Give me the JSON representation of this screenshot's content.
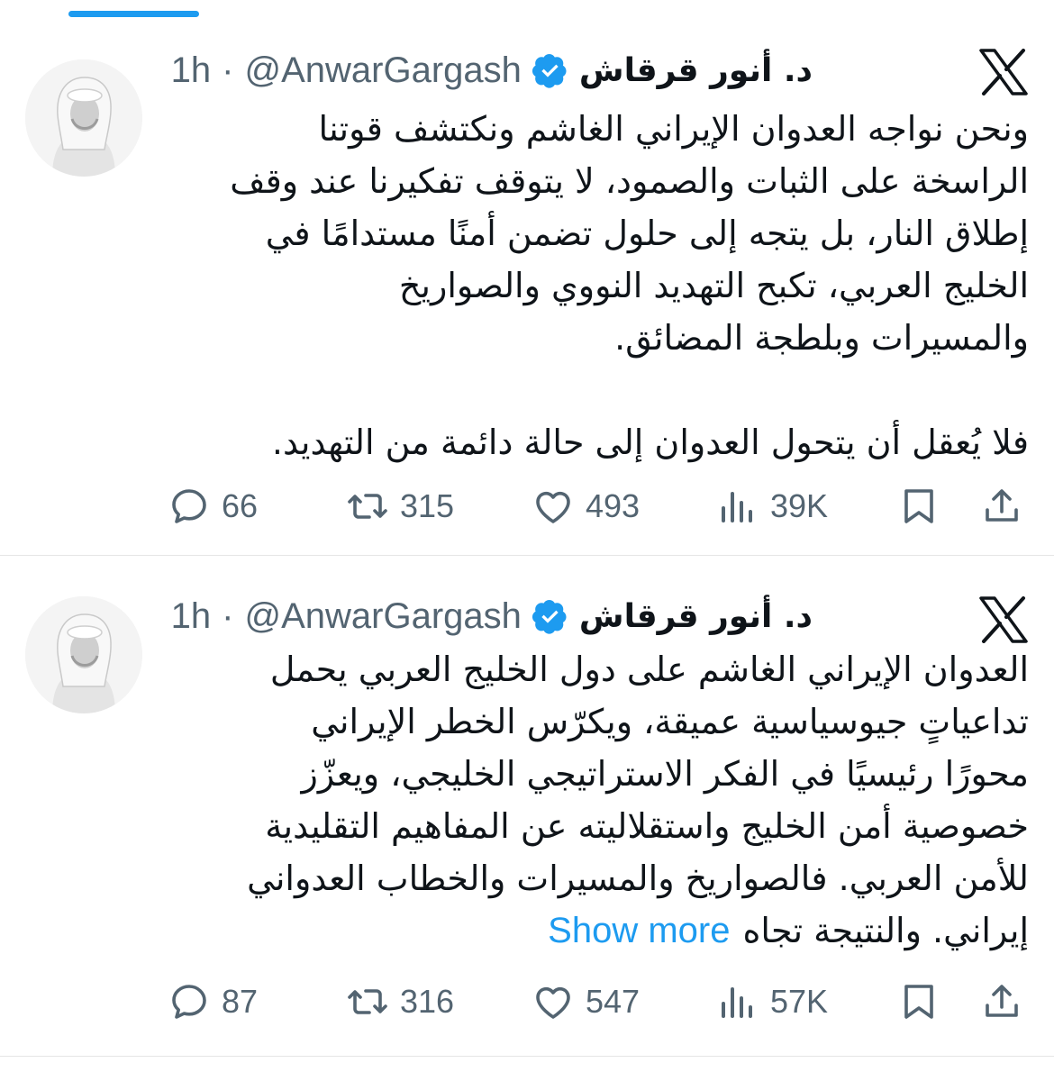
{
  "tweets": [
    {
      "author_name": "د. أنور قرقاش",
      "handle": "@AnwarGargash",
      "separator": "·",
      "time": "1h",
      "lines": [
        "ونحن نواجه العدوان الإيراني الغاشم ونكتشف قوتنا",
        "الراسخة على الثبات والصمود، لا يتوقف تفكيرنا عند وقف",
        "إطلاق النار، بل يتجه إلى حلول تضمن أمنًا مستدامًا في",
        "الخليج العربي، تكبح التهديد النووي والصواريخ",
        "والمسيرات وبلطجة المضائق."
      ],
      "last_paragraph": "فلا يُعقل أن يتحول العدوان إلى حالة دائمة من التهديد.",
      "metrics": {
        "replies": "66",
        "retweets": "315",
        "likes": "493",
        "views": "39K"
      }
    },
    {
      "author_name": "د. أنور قرقاش",
      "handle": "@AnwarGargash",
      "separator": "·",
      "time": "1h",
      "lines": [
        "العدوان الإيراني الغاشم على دول الخليج العربي يحمل",
        "تداعياتٍ جيوسياسية عميقة، ويكرّس الخطر الإيراني",
        "محورًا رئيسيًا في الفكر الاستراتيجي الخليجي، ويعزّز",
        "خصوصية أمن الخليج واستقلاليته عن المفاهيم التقليدية",
        "للأمن العربي. فالصواريخ والمسيرات والخطاب العدواني"
      ],
      "truncated_line": "إيراني. والنتيجة تجاه",
      "show_more": "Show more",
      "metrics": {
        "replies": "87",
        "retweets": "316",
        "likes": "547",
        "views": "57K"
      }
    }
  ],
  "icons": {
    "close": "x-logo-icon",
    "verified": "verified-badge-icon",
    "reply": "reply-icon",
    "retweet": "retweet-icon",
    "like": "heart-icon",
    "views": "views-icon",
    "bookmark": "bookmark-icon",
    "share": "share-icon"
  },
  "colors": {
    "accent": "#1d9bf0",
    "text": "#0f1419",
    "secondary": "#536471",
    "divider": "#e6e6e6"
  }
}
